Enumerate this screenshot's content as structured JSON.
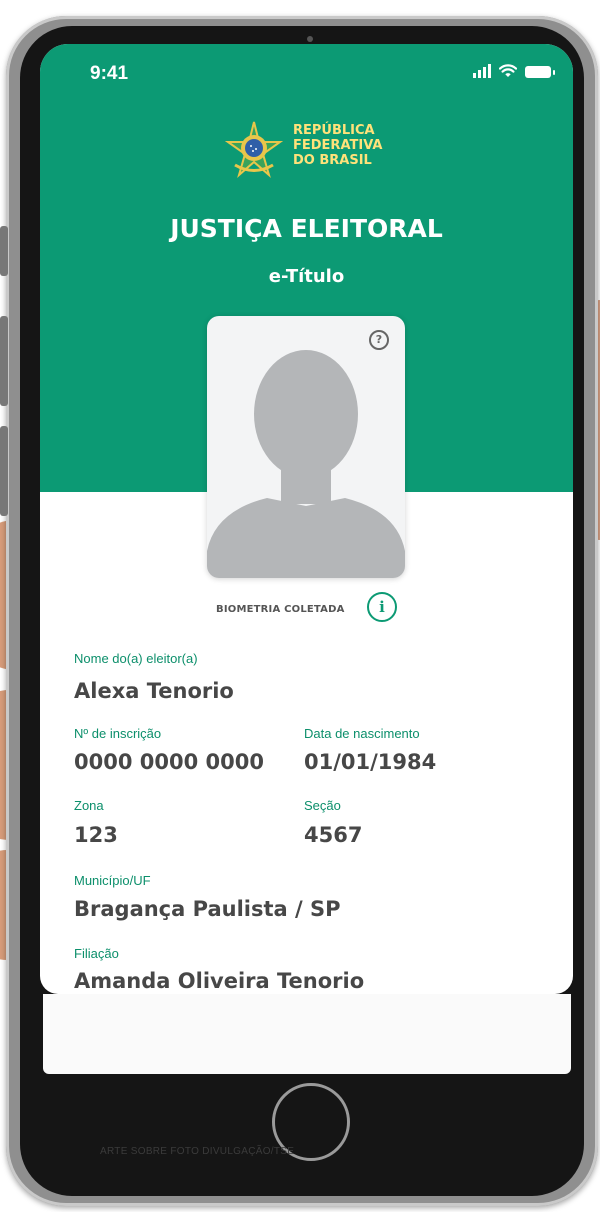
{
  "status": {
    "time": "9:41"
  },
  "header": {
    "republic_lines": [
      "REPÚBLICA",
      "FEDERATIVA",
      "DO BRASIL"
    ],
    "title": "JUSTIÇA ELEITORAL",
    "subtitle": "e-Título"
  },
  "photo": {
    "help_glyph": "?",
    "biometria_label": "BIOMETRIA COLETADA",
    "info_glyph": "i"
  },
  "fields": {
    "nome_label": "Nome do(a) eleitor(a)",
    "nome_value": "Alexa Tenorio",
    "inscricao_label": "Nº de inscrição",
    "inscricao_value": "0000 0000 0000",
    "nascimento_label": "Data de nascimento",
    "nascimento_value": "01/01/1984",
    "zona_label": "Zona",
    "zona_value": "123",
    "secao_label": "Seção",
    "secao_value": "4567",
    "municipio_label": "Município/UF",
    "municipio_value": "Bragança Paulista / SP",
    "filiacao_label": "Filiação",
    "filiacao_value": "Amanda Oliveira Tenorio"
  },
  "watermark": "ARTE SOBRE FOTO DIVULGAÇÃO/TSE",
  "colors": {
    "primary_green": "#0c9a74",
    "emblem_gold": "#ffe27a",
    "text_dark": "#474747"
  },
  "icons": [
    "signal-icon",
    "wifi-icon",
    "battery-icon",
    "brasil-emblem-icon",
    "help-icon",
    "info-icon",
    "avatar-silhouette-icon"
  ]
}
